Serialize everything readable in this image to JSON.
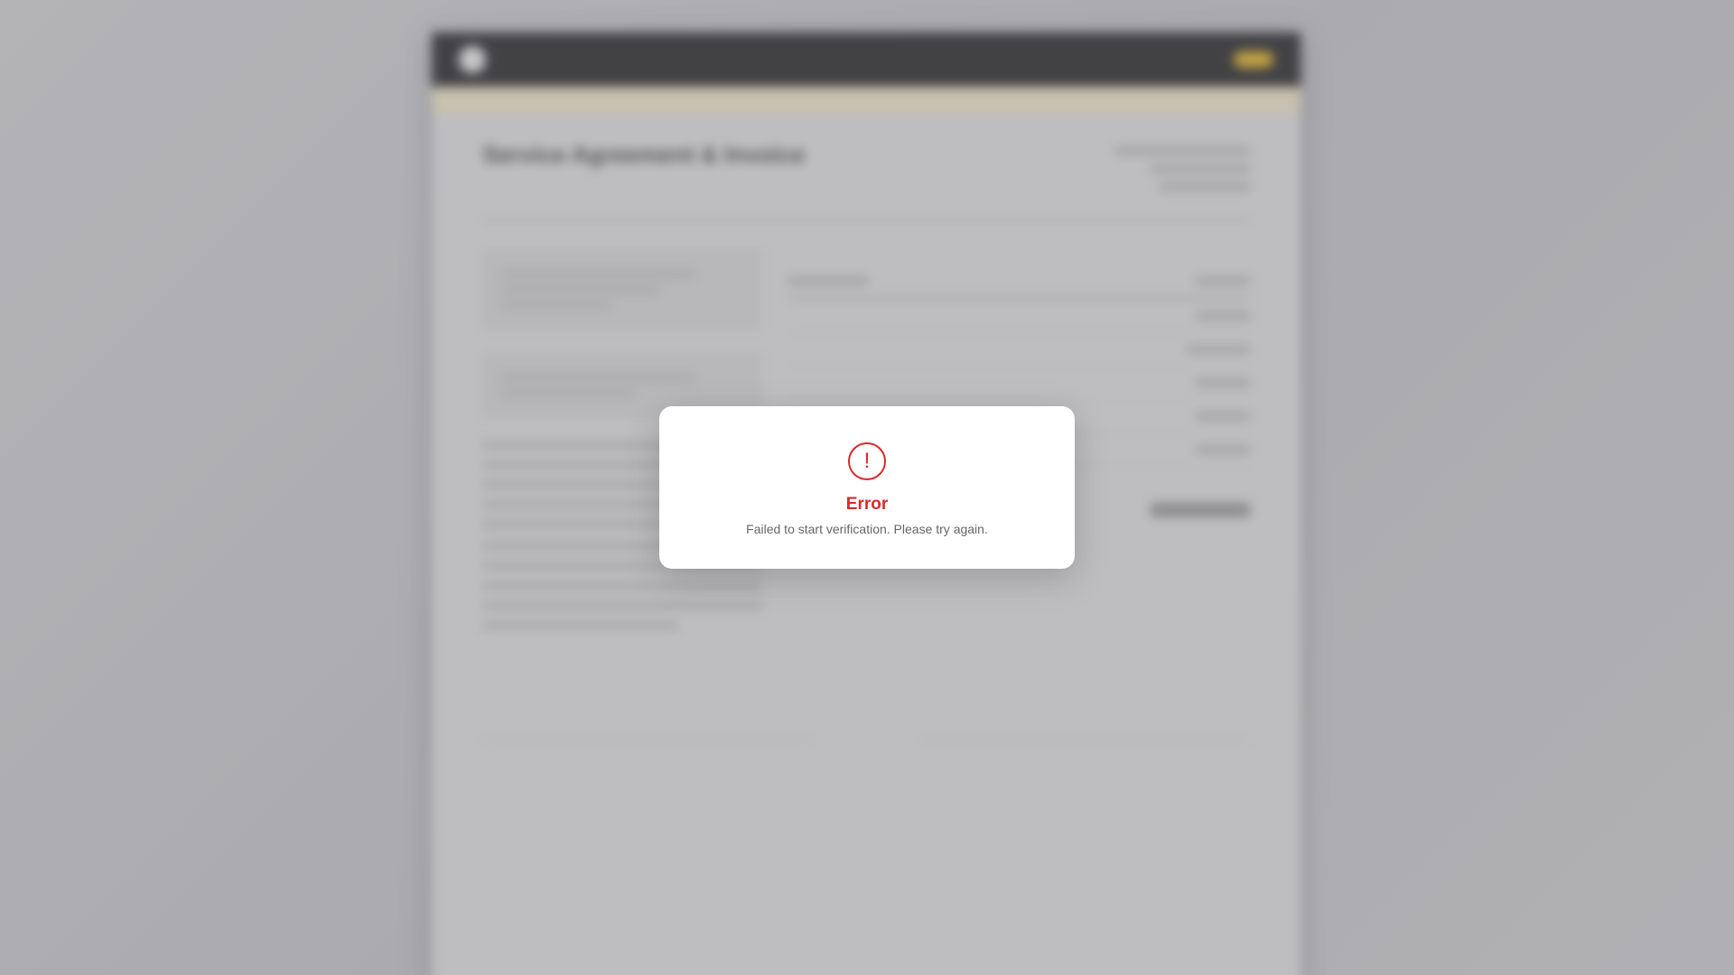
{
  "background": {
    "brand": "",
    "nav_link": "",
    "nav_button": "",
    "banner": "",
    "doc_title": "Service Agreement & Invoice",
    "doc_sub": "",
    "parties": [
      {
        "label": "",
        "name": ""
      },
      {
        "label": "",
        "name": ""
      }
    ],
    "section_headings": [
      "",
      ""
    ],
    "table_title": "",
    "table_rows": [
      "",
      "",
      "",
      "",
      ""
    ],
    "signature_labels": [
      "",
      ""
    ],
    "signature_names": [
      "",
      ""
    ]
  },
  "modal": {
    "icon_glyph": "!",
    "title": "Error",
    "message": "Failed to start verification. Please try again."
  },
  "colors": {
    "error": "#d62b2b",
    "accent": "#e2b21c",
    "topbar": "#1b1b1d"
  }
}
